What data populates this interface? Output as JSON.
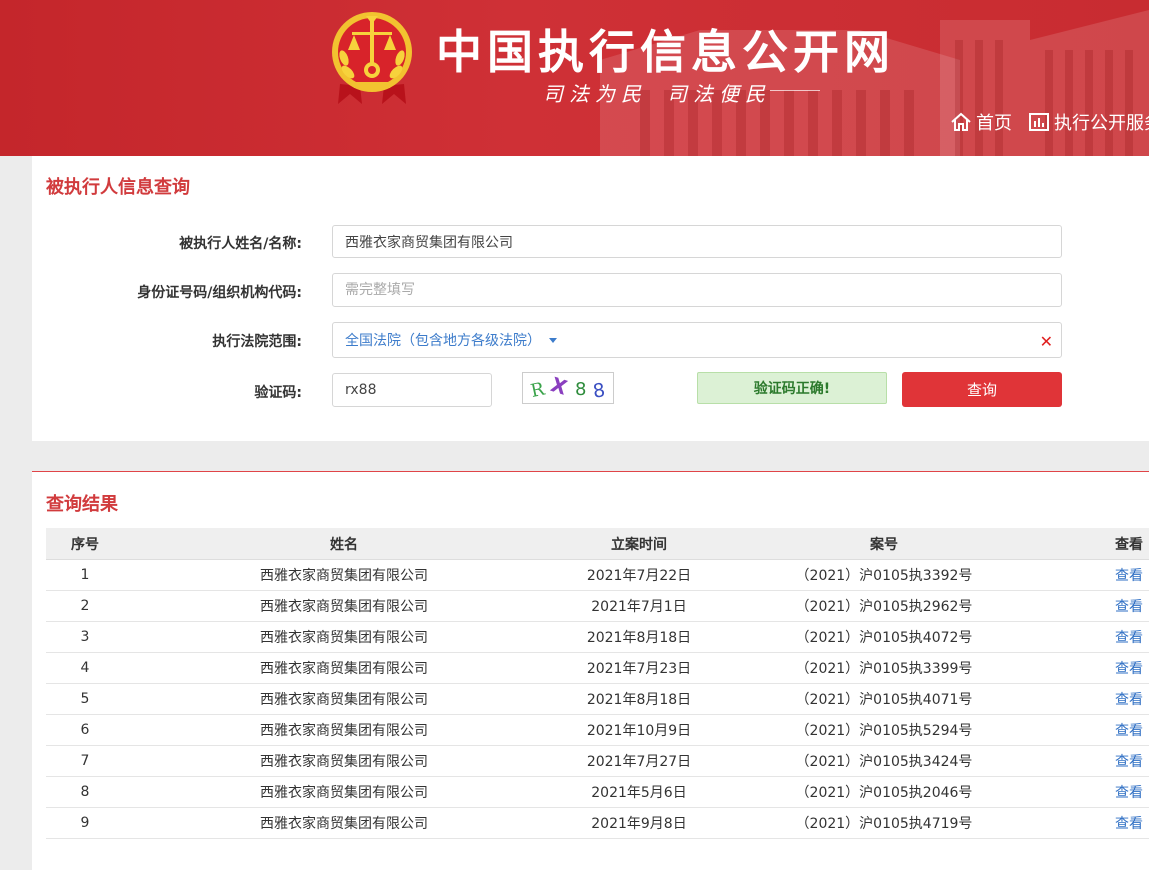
{
  "header": {
    "site_title": "中国执行信息公开网",
    "slogan_1": "司法为民",
    "slogan_2": "司法便民",
    "nav": [
      {
        "label": "首页",
        "icon": "home-icon"
      },
      {
        "label": "执行公开服务",
        "icon": "chart-icon"
      }
    ]
  },
  "query": {
    "title": "被执行人信息查询",
    "name_label": "被执行人姓名/名称:",
    "name_value": "西雅衣家商贸集团有限公司",
    "id_label": "身份证号码/组织机构代码:",
    "id_placeholder": "需完整填写",
    "court_label": "执行法院范围:",
    "court_value": "全国法院（包含地方各级法院）",
    "captcha_label": "验证码:",
    "captcha_value": "rx88",
    "captcha_chars": [
      "R",
      "X",
      "8",
      "8"
    ],
    "verify_message": "验证码正确!",
    "search_button": "查询"
  },
  "results": {
    "title": "查询结果",
    "columns": [
      "序号",
      "姓名",
      "立案时间",
      "案号",
      "查看"
    ],
    "rows": [
      {
        "no": "1",
        "name": "西雅衣家商贸集团有限公司",
        "date": "2021年7月22日",
        "case": "（2021）沪0105执3392号",
        "view": "查看"
      },
      {
        "no": "2",
        "name": "西雅衣家商贸集团有限公司",
        "date": "2021年7月1日",
        "case": "（2021）沪0105执2962号",
        "view": "查看"
      },
      {
        "no": "3",
        "name": "西雅衣家商贸集团有限公司",
        "date": "2021年8月18日",
        "case": "（2021）沪0105执4072号",
        "view": "查看"
      },
      {
        "no": "4",
        "name": "西雅衣家商贸集团有限公司",
        "date": "2021年7月23日",
        "case": "（2021）沪0105执3399号",
        "view": "查看"
      },
      {
        "no": "5",
        "name": "西雅衣家商贸集团有限公司",
        "date": "2021年8月18日",
        "case": "（2021）沪0105执4071号",
        "view": "查看"
      },
      {
        "no": "6",
        "name": "西雅衣家商贸集团有限公司",
        "date": "2021年10月9日",
        "case": "（2021）沪0105执5294号",
        "view": "查看"
      },
      {
        "no": "7",
        "name": "西雅衣家商贸集团有限公司",
        "date": "2021年7月27日",
        "case": "（2021）沪0105执3424号",
        "view": "查看"
      },
      {
        "no": "8",
        "name": "西雅衣家商贸集团有限公司",
        "date": "2021年5月6日",
        "case": "（2021）沪0105执2046号",
        "view": "查看"
      },
      {
        "no": "9",
        "name": "西雅衣家商贸集团有限公司",
        "date": "2021年9月8日",
        "case": "（2021）沪0105执4719号",
        "view": "查看"
      }
    ]
  },
  "colors": {
    "brand_red": "#c4262b",
    "title_red": "#d13b3d",
    "link_blue": "#2f6fc4",
    "success_bg": "#dcf1d5"
  }
}
